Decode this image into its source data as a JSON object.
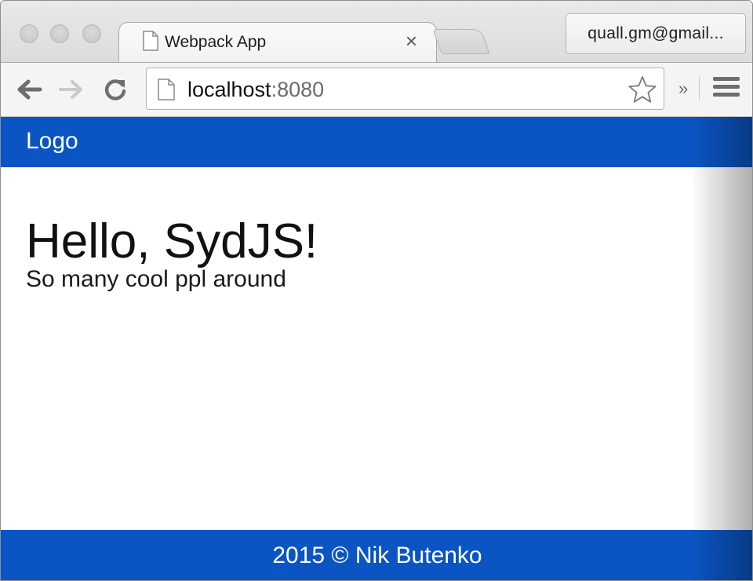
{
  "browser": {
    "tab": {
      "title": "Webpack App",
      "close_glyph": "×",
      "icon": "page-icon"
    },
    "profile": {
      "label": "quall.gm@gmail..."
    },
    "toolbar": {
      "back_icon": "arrow-left-icon",
      "forward_icon": "arrow-right-icon",
      "reload_icon": "reload-icon",
      "url_host": "localhost",
      "url_port": ":8080",
      "bookmark_icon": "star-icon",
      "extensions_glyph": "»",
      "menu_icon": "hamburger-menu-icon"
    }
  },
  "page": {
    "navbar": {
      "logo": "Logo",
      "color": "#0a55c3"
    },
    "main": {
      "heading": "Hello, SydJS!",
      "subheading": "So many cool ppl around"
    },
    "footer": {
      "text": "2015 © Nik Butenko",
      "color": "#0a55c3"
    }
  }
}
